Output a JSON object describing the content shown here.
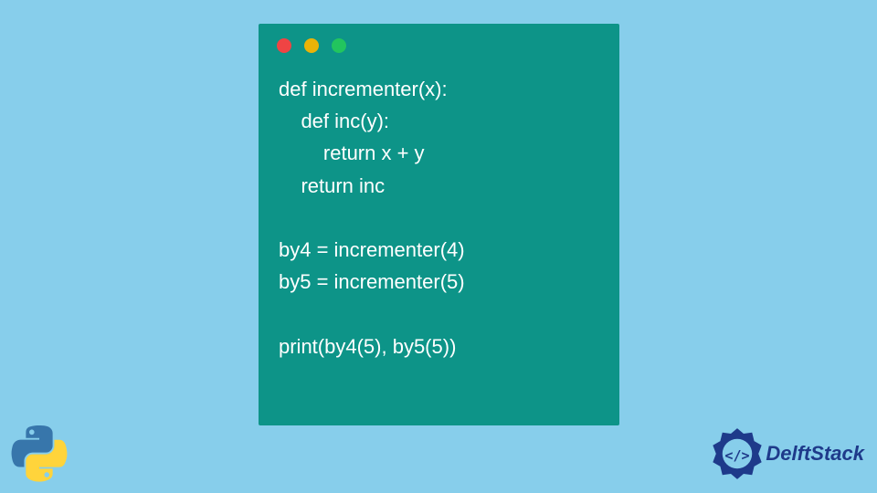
{
  "code": {
    "lines": [
      "def incrementer(x):",
      "    def inc(y):",
      "        return x + y",
      "    return inc",
      "",
      "by4 = incrementer(4)",
      "by5 = incrementer(5)",
      "",
      "print(by4(5), by5(5))"
    ]
  },
  "traffic_lights": {
    "red": "#ef4444",
    "yellow": "#eab308",
    "green": "#22c55e"
  },
  "branding": {
    "delftstack_label": "DelftStack"
  }
}
